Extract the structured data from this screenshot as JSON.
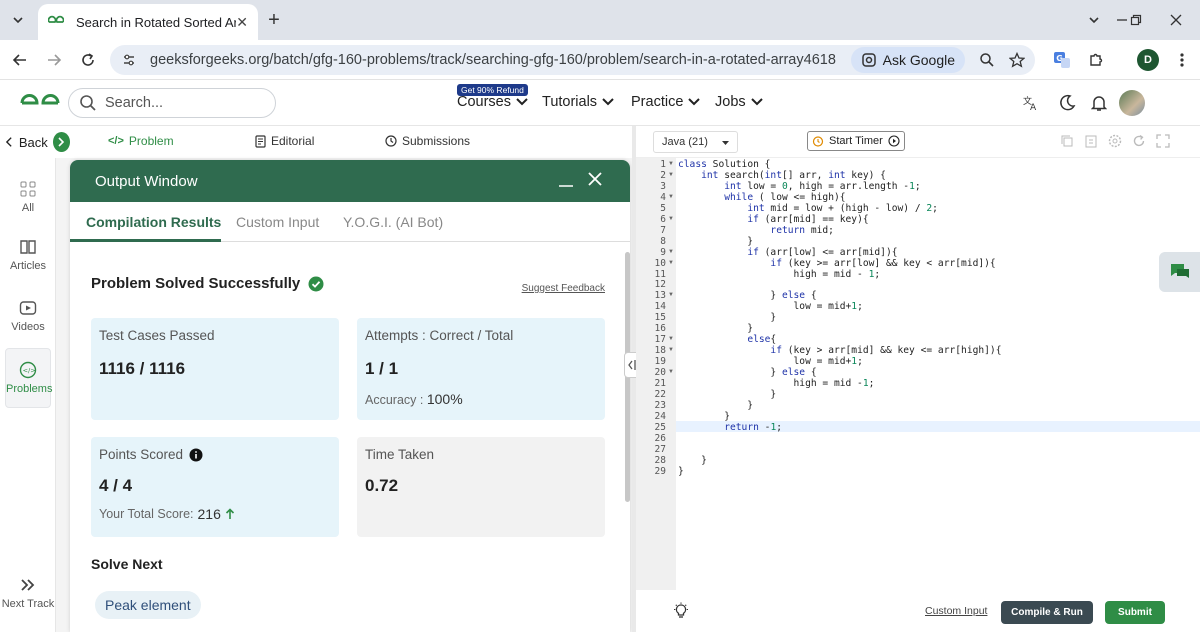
{
  "browser": {
    "tab_title": "Search in Rotated Sorted Array",
    "url": "geeksforgeeks.org/batch/gfg-160-problems/track/searching-gfg-160/problem/search-in-a-rotated-array4618",
    "ask_google": "Ask Google",
    "profile_initial": "D"
  },
  "site": {
    "search_placeholder": "Search...",
    "refund_badge": "Get 90% Refund",
    "nav": [
      "Courses",
      "Tutorials",
      "Practice",
      "Jobs"
    ]
  },
  "problem_tabs": {
    "back": "Back",
    "problem": "Problem",
    "editorial": "Editorial",
    "submissions": "Submissions"
  },
  "sidebar": {
    "items": [
      "All",
      "Articles",
      "Videos",
      "Problems"
    ],
    "next_track": "Next Track"
  },
  "output_window": {
    "title": "Output Window",
    "tabs": [
      "Compilation Results",
      "Custom Input",
      "Y.O.G.I. (AI Bot)"
    ],
    "status": "Problem Solved Successfully",
    "suggest_feedback": "Suggest Feedback",
    "test_cases_label": "Test Cases Passed",
    "test_cases_value": "1116 / 1116",
    "attempts_label": "Attempts : Correct / Total",
    "attempts_value": "1 / 1",
    "accuracy_label": "Accuracy :",
    "accuracy_value": "100%",
    "points_label": "Points Scored",
    "points_value": "4 / 4",
    "total_score_label": "Your Total Score:",
    "total_score_value": "216",
    "time_label": "Time Taken",
    "time_value": "0.72",
    "solve_next": "Solve Next",
    "next_problem": "Peak element"
  },
  "editor": {
    "language": "Java (21)",
    "start_timer": "Start Timer",
    "custom_input": "Custom Input",
    "compile_run": "Compile & Run",
    "submit": "Submit",
    "line_numbers": [
      "1",
      "2",
      "3",
      "4",
      "5",
      "6",
      "7",
      "8",
      "9",
      "10",
      "11",
      "12",
      "13",
      "14",
      "15",
      "16",
      "17",
      "18",
      "19",
      "20",
      "21",
      "22",
      "23",
      "24",
      "25",
      "26",
      "27",
      "28",
      "29"
    ],
    "code_lines": [
      "class Solution {",
      "    int search(int[] arr, int key) {",
      "        int low = 0, high = arr.length -1;",
      "        while ( low <= high){",
      "            int mid = low + (high - low) / 2;",
      "            if (arr[mid] == key){",
      "                return mid;",
      "            }",
      "            if (arr[low] <= arr[mid]){",
      "                if (key >= arr[low] && key < arr[mid]){",
      "                    high = mid - 1;",
      "",
      "                } else {",
      "                    low = mid+1;",
      "                }",
      "            }",
      "            else{",
      "                if (key > arr[mid] && key <= arr[high]){",
      "                    low = mid+1;",
      "                } else {",
      "                    high = mid -1;",
      "                }",
      "            }",
      "        }",
      "        return -1;",
      "",
      "",
      "    }",
      "}"
    ]
  },
  "colors": {
    "brand_green": "#2f8d46",
    "output_header": "#2f6b4f",
    "card_blue": "#e6f4fa",
    "card_grey": "#f2f2f2"
  }
}
